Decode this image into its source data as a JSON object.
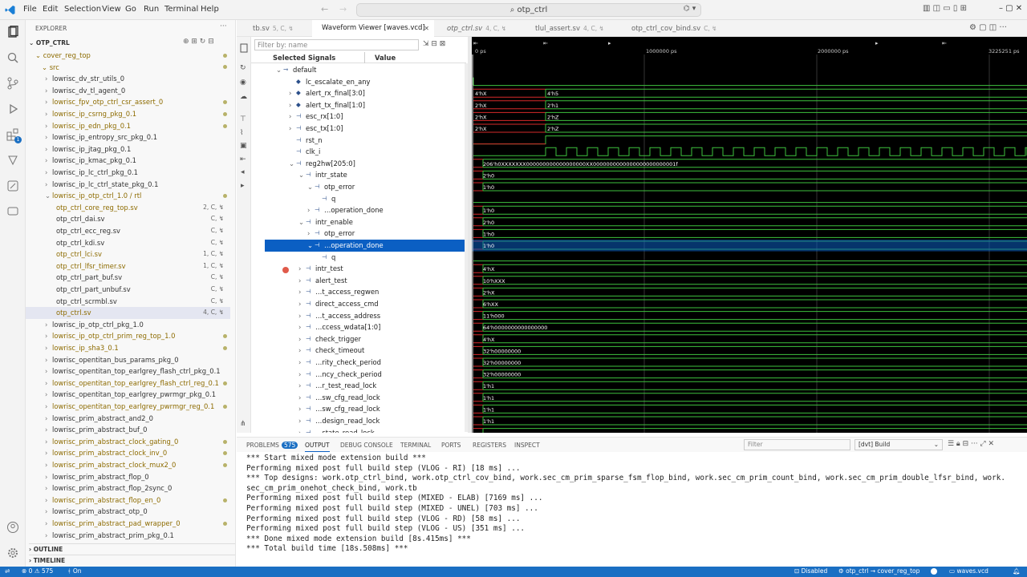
{
  "window": {
    "search": "otp_ctrl",
    "menu": [
      "File",
      "Edit",
      "Selection",
      "View",
      "Go",
      "Run",
      "Terminal",
      "Help"
    ]
  },
  "explorer": {
    "title": "EXPLORER",
    "project": "OTP_CTRL",
    "folder": "cover_reg_top",
    "src": "src",
    "items": [
      {
        "label": "lowrisc_dv_str_utils_0",
        "indent": 1,
        "mod": false,
        "badge": ""
      },
      {
        "label": "lowrisc_dv_tl_agent_0",
        "indent": 1,
        "mod": false,
        "badge": ""
      },
      {
        "label": "lowrisc_fpv_otp_ctrl_csr_assert_0",
        "indent": 1,
        "mod": true,
        "badge": ""
      },
      {
        "label": "lowrisc_ip_csrng_pkg_0.1",
        "indent": 1,
        "mod": true,
        "badge": ""
      },
      {
        "label": "lowrisc_ip_edn_pkg_0.1",
        "indent": 1,
        "mod": true,
        "badge": ""
      },
      {
        "label": "lowrisc_ip_entropy_src_pkg_0.1",
        "indent": 1,
        "mod": false,
        "badge": ""
      },
      {
        "label": "lowrisc_ip_jtag_pkg_0.1",
        "indent": 1,
        "mod": false,
        "badge": ""
      },
      {
        "label": "lowrisc_ip_kmac_pkg_0.1",
        "indent": 1,
        "mod": false,
        "badge": ""
      },
      {
        "label": "lowrisc_ip_lc_ctrl_pkg_0.1",
        "indent": 1,
        "mod": false,
        "badge": ""
      },
      {
        "label": "lowrisc_ip_lc_ctrl_state_pkg_0.1",
        "indent": 1,
        "mod": false,
        "badge": ""
      },
      {
        "label": "lowrisc_ip_otp_ctrl_1.0 / rtl",
        "indent": 1,
        "mod": true,
        "badge": "",
        "open": true
      },
      {
        "label": "otp_ctrl_core_reg_top.sv",
        "indent": 2,
        "mod": true,
        "badge": "2, C, ↯"
      },
      {
        "label": "otp_ctrl_dai.sv",
        "indent": 2,
        "mod": false,
        "badge": "C, ↯"
      },
      {
        "label": "otp_ctrl_ecc_reg.sv",
        "indent": 2,
        "mod": false,
        "badge": "C, ↯"
      },
      {
        "label": "otp_ctrl_kdi.sv",
        "indent": 2,
        "mod": false,
        "badge": "C, ↯"
      },
      {
        "label": "otp_ctrl_lci.sv",
        "indent": 2,
        "mod": true,
        "badge": "1, C, ↯"
      },
      {
        "label": "otp_ctrl_lfsr_timer.sv",
        "indent": 2,
        "mod": true,
        "badge": "1, C, ↯"
      },
      {
        "label": "otp_ctrl_part_buf.sv",
        "indent": 2,
        "mod": false,
        "badge": "C, ↯"
      },
      {
        "label": "otp_ctrl_part_unbuf.sv",
        "indent": 2,
        "mod": false,
        "badge": "C, ↯"
      },
      {
        "label": "otp_ctrl_scrmbl.sv",
        "indent": 2,
        "mod": false,
        "badge": "C, ↯"
      },
      {
        "label": "otp_ctrl.sv",
        "indent": 2,
        "mod": true,
        "badge": "4, C, ↯",
        "selected": true
      },
      {
        "label": "lowrisc_ip_otp_ctrl_pkg_1.0",
        "indent": 1,
        "mod": false,
        "badge": ""
      },
      {
        "label": "lowrisc_ip_otp_ctrl_prim_reg_top_1.0",
        "indent": 1,
        "mod": true,
        "badge": ""
      },
      {
        "label": "lowrisc_ip_sha3_0.1",
        "indent": 1,
        "mod": true,
        "badge": ""
      },
      {
        "label": "lowrisc_opentitan_bus_params_pkg_0",
        "indent": 1,
        "mod": false,
        "badge": ""
      },
      {
        "label": "lowrisc_opentitan_top_earlgrey_flash_ctrl_pkg_0.1",
        "indent": 1,
        "mod": false,
        "badge": ""
      },
      {
        "label": "lowrisc_opentitan_top_earlgrey_flash_ctrl_reg_0.1",
        "indent": 1,
        "mod": true,
        "badge": ""
      },
      {
        "label": "lowrisc_opentitan_top_earlgrey_pwrmgr_pkg_0.1",
        "indent": 1,
        "mod": false,
        "badge": ""
      },
      {
        "label": "lowrisc_opentitan_top_earlgrey_pwrmgr_reg_0.1",
        "indent": 1,
        "mod": true,
        "badge": ""
      },
      {
        "label": "lowrisc_prim_abstract_and2_0",
        "indent": 1,
        "mod": false,
        "badge": ""
      },
      {
        "label": "lowrisc_prim_abstract_buf_0",
        "indent": 1,
        "mod": false,
        "badge": ""
      },
      {
        "label": "lowrisc_prim_abstract_clock_gating_0",
        "indent": 1,
        "mod": true,
        "badge": ""
      },
      {
        "label": "lowrisc_prim_abstract_clock_inv_0",
        "indent": 1,
        "mod": true,
        "badge": ""
      },
      {
        "label": "lowrisc_prim_abstract_clock_mux2_0",
        "indent": 1,
        "mod": true,
        "badge": ""
      },
      {
        "label": "lowrisc_prim_abstract_flop_0",
        "indent": 1,
        "mod": false,
        "badge": ""
      },
      {
        "label": "lowrisc_prim_abstract_flop_2sync_0",
        "indent": 1,
        "mod": false,
        "badge": ""
      },
      {
        "label": "lowrisc_prim_abstract_flop_en_0",
        "indent": 1,
        "mod": true,
        "badge": ""
      },
      {
        "label": "lowrisc_prim_abstract_otp_0",
        "indent": 1,
        "mod": false,
        "badge": ""
      },
      {
        "label": "lowrisc_prim_abstract_pad_wrapper_0",
        "indent": 1,
        "mod": true,
        "badge": ""
      },
      {
        "label": "lowrisc_prim_abstract_prim_pkg_0.1",
        "indent": 1,
        "mod": false,
        "badge": ""
      }
    ],
    "outline": "OUTLINE",
    "timeline": "TIMELINE"
  },
  "tabs": [
    {
      "label": "tb.sv",
      "meta": "5, C, ↯"
    },
    {
      "label": "Waveform Viewer [waves.vcd]",
      "meta": "",
      "active": true
    },
    {
      "label": "otp_ctrl.sv",
      "meta": "4, C, ↯"
    },
    {
      "label": "tlul_assert.sv",
      "meta": "4, C, ↯"
    },
    {
      "label": "otp_ctrl_cov_bind.sv",
      "meta": "C, ↯"
    }
  ],
  "waveform": {
    "filter_placeholder": "Filter by: name",
    "col_signals": "Selected Signals",
    "col_value": "Value",
    "time_labels": [
      "0 ps",
      "1000000 ps",
      "2000000 ps",
      "3225251 ps"
    ],
    "signals": [
      {
        "name": "default",
        "indent": 0,
        "expander": "▾"
      },
      {
        "name": "lc_escalate_en_any",
        "indent": 1,
        "expander": ""
      },
      {
        "name": "alert_rx_final[3:0]",
        "indent": 1,
        "expander": "›"
      },
      {
        "name": "alert_tx_final[1:0]",
        "indent": 1,
        "expander": "›"
      },
      {
        "name": "esc_rx[1:0]",
        "indent": 1,
        "expander": "›"
      },
      {
        "name": "esc_tx[1:0]",
        "indent": 1,
        "expander": "›"
      },
      {
        "name": "rst_n",
        "indent": 1,
        "expander": ""
      },
      {
        "name": "clk_i",
        "indent": 1,
        "expander": ""
      },
      {
        "name": "reg2hw[205:0]",
        "indent": 1,
        "expander": "▾"
      },
      {
        "name": "intr_state",
        "indent": 2,
        "expander": "▾"
      },
      {
        "name": "otp_error",
        "indent": 3,
        "expander": "▾"
      },
      {
        "name": "q",
        "indent": 4,
        "expander": ""
      },
      {
        "name": "…operation_done",
        "indent": 3,
        "expander": "›"
      },
      {
        "name": "intr_enable",
        "indent": 2,
        "expander": "▾"
      },
      {
        "name": "otp_error",
        "indent": 3,
        "expander": "›"
      },
      {
        "name": "…operation_done",
        "indent": 3,
        "expander": "▾",
        "selected": true
      },
      {
        "name": "q",
        "indent": 4,
        "expander": ""
      },
      {
        "name": "intr_test",
        "indent": 2,
        "expander": "›"
      },
      {
        "name": "alert_test",
        "indent": 2,
        "expander": "›"
      },
      {
        "name": "…t_access_regwen",
        "indent": 2,
        "expander": "›"
      },
      {
        "name": "direct_access_cmd",
        "indent": 2,
        "expander": "›"
      },
      {
        "name": "…t_access_address",
        "indent": 2,
        "expander": "›"
      },
      {
        "name": "…ccess_wdata[1:0]",
        "indent": 2,
        "expander": "›"
      },
      {
        "name": "check_trigger",
        "indent": 2,
        "expander": "›"
      },
      {
        "name": "check_timeout",
        "indent": 2,
        "expander": "›"
      },
      {
        "name": "…rity_check_period",
        "indent": 2,
        "expander": "›"
      },
      {
        "name": "…ncy_check_period",
        "indent": 2,
        "expander": "›"
      },
      {
        "name": "…r_test_read_lock",
        "indent": 2,
        "expander": "›"
      },
      {
        "name": "…sw_cfg_read_lock",
        "indent": 2,
        "expander": "›"
      },
      {
        "name": "…sw_cfg_read_lock",
        "indent": 2,
        "expander": "›"
      },
      {
        "name": "…design_read_lock",
        "indent": 2,
        "expander": "›"
      },
      {
        "name": "…state_read_lock",
        "indent": 2,
        "expander": "›"
      }
    ],
    "values": [
      {
        "row": 0,
        "v0": "",
        "v1": ""
      },
      {
        "row": 1,
        "v0": "",
        "v1": ""
      },
      {
        "row": 2,
        "v0": "4'hX",
        "v1": "4'h5"
      },
      {
        "row": 3,
        "v0": "2'hX",
        "v1": "2'h1"
      },
      {
        "row": 4,
        "v0": "2'hX",
        "v1": "2'hZ"
      },
      {
        "row": 5,
        "v0": "2'hX",
        "v1": "2'hZ"
      },
      {
        "row": 8,
        "v0": "206'h0XXXXXXX000000000000000000XX0000000000000000000000001f",
        "v1": ""
      },
      {
        "row": 9,
        "v0": "2'h0",
        "v1": ""
      },
      {
        "row": 10,
        "v0": "1'h0",
        "v1": ""
      },
      {
        "row": 12,
        "v0": "1'h0",
        "v1": ""
      },
      {
        "row": 13,
        "v0": "2'h0",
        "v1": ""
      },
      {
        "row": 14,
        "v0": "1'h0",
        "v1": ""
      },
      {
        "row": 15,
        "v0": "1'h0",
        "v1": ""
      },
      {
        "row": 17,
        "v0": "4'hX",
        "v1": ""
      },
      {
        "row": 18,
        "v0": "10'hXXX",
        "v1": ""
      },
      {
        "row": 19,
        "v0": "2'hX",
        "v1": ""
      },
      {
        "row": 20,
        "v0": "6'hXX",
        "v1": ""
      },
      {
        "row": 21,
        "v0": "11'h000",
        "v1": ""
      },
      {
        "row": 22,
        "v0": "64'h0000000000000000",
        "v1": ""
      },
      {
        "row": 23,
        "v0": "4'hX",
        "v1": ""
      },
      {
        "row": 24,
        "v0": "32'h00000000",
        "v1": ""
      },
      {
        "row": 25,
        "v0": "32'h00000000",
        "v1": ""
      },
      {
        "row": 26,
        "v0": "32'h00000000",
        "v1": ""
      },
      {
        "row": 27,
        "v0": "1'h1",
        "v1": ""
      },
      {
        "row": 28,
        "v0": "1'h1",
        "v1": ""
      },
      {
        "row": 29,
        "v0": "1'h1",
        "v1": ""
      },
      {
        "row": 30,
        "v0": "1'h1",
        "v1": ""
      }
    ]
  },
  "panel": {
    "tabs": [
      "PROBLEMS",
      "OUTPUT",
      "DEBUG CONSOLE",
      "TERMINAL",
      "PORTS",
      "REGISTERS",
      "INSPECT"
    ],
    "problems_count": "575",
    "filter_placeholder": "Filter",
    "channel": "[dvt] Build",
    "lines": [
      "*** Start mixed mode extension build ***",
      "Performing mixed post full build step (VLOG - RI) [18 ms] ...",
      "*** Top designs: work.otp_ctrl_bind, work.otp_ctrl_cov_bind, work.sec_cm_prim_sparse_fsm_flop_bind, work.sec_cm_prim_count_bind, work.sec_cm_prim_double_lfsr_bind, work.",
      "sec_cm_prim_onehot_check_bind, work.tb",
      "Performing mixed post full build step (MIXED - ELAB) [7169 ms] ...",
      "Performing mixed post full build step (MIXED - UNEL) [703 ms] ...",
      "Performing mixed post full build step (VLOG - RD) [58 ms] ...",
      "Performing mixed post full build step (VLOG - US) [351 ms] ...",
      "*** Done mixed mode extension build [8s.415ms] ***",
      "*** Total build time [18s.508ms] ***"
    ]
  },
  "status": {
    "errors": "0",
    "warnings": "575",
    "on": "On",
    "disabled": "Disabled",
    "context": "otp_ctrl → cover_reg_top",
    "file": "waves.vcd"
  },
  "colors": {
    "accent": "#0b5fc3",
    "wave_green": "#3ec23e",
    "wave_red": "#d62a2a",
    "status_bg": "#1a6fc3"
  }
}
